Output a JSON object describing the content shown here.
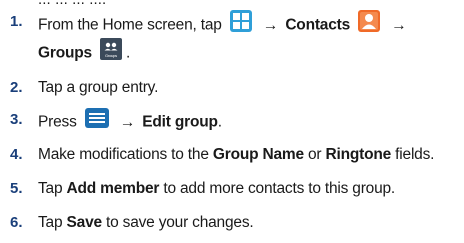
{
  "top_sliver": "... ... ... ....",
  "steps": [
    {
      "number": "1.",
      "line1": {
        "t1": "From the Home screen, tap",
        "arrow1": "→",
        "t2": "Contacts",
        "arrow2": "→"
      },
      "line2": {
        "t3": "Groups",
        "t4": "."
      },
      "icons": {
        "apps": "apps-grid-icon",
        "contacts": "contacts-icon",
        "groups": "groups-icon",
        "groups_caption": "Groups"
      }
    },
    {
      "number": "2.",
      "text": "Tap a group entry."
    },
    {
      "number": "3.",
      "t1": "Press",
      "arrow": "→",
      "t2": "Edit group",
      "t3": ".",
      "icon": "menu-key-icon"
    },
    {
      "number": "4.",
      "t1": "Make modifications to the",
      "t2": "Group Name",
      "t3": "or",
      "t4": "Ringtone",
      "t5": "fields."
    },
    {
      "number": "5.",
      "t1": "Tap",
      "t2": "Add member",
      "t3": "to add more contacts to this group."
    },
    {
      "number": "6.",
      "t1": "Tap",
      "t2": "Save",
      "t3": "to save your changes."
    }
  ],
  "colors": {
    "number": "#1a3f7a",
    "apps_icon": "#2f9fd8",
    "contacts_icon": "#f06a28",
    "groups_icon": "#3b4a5a",
    "menu_key_icon": "#1d6fb2"
  }
}
